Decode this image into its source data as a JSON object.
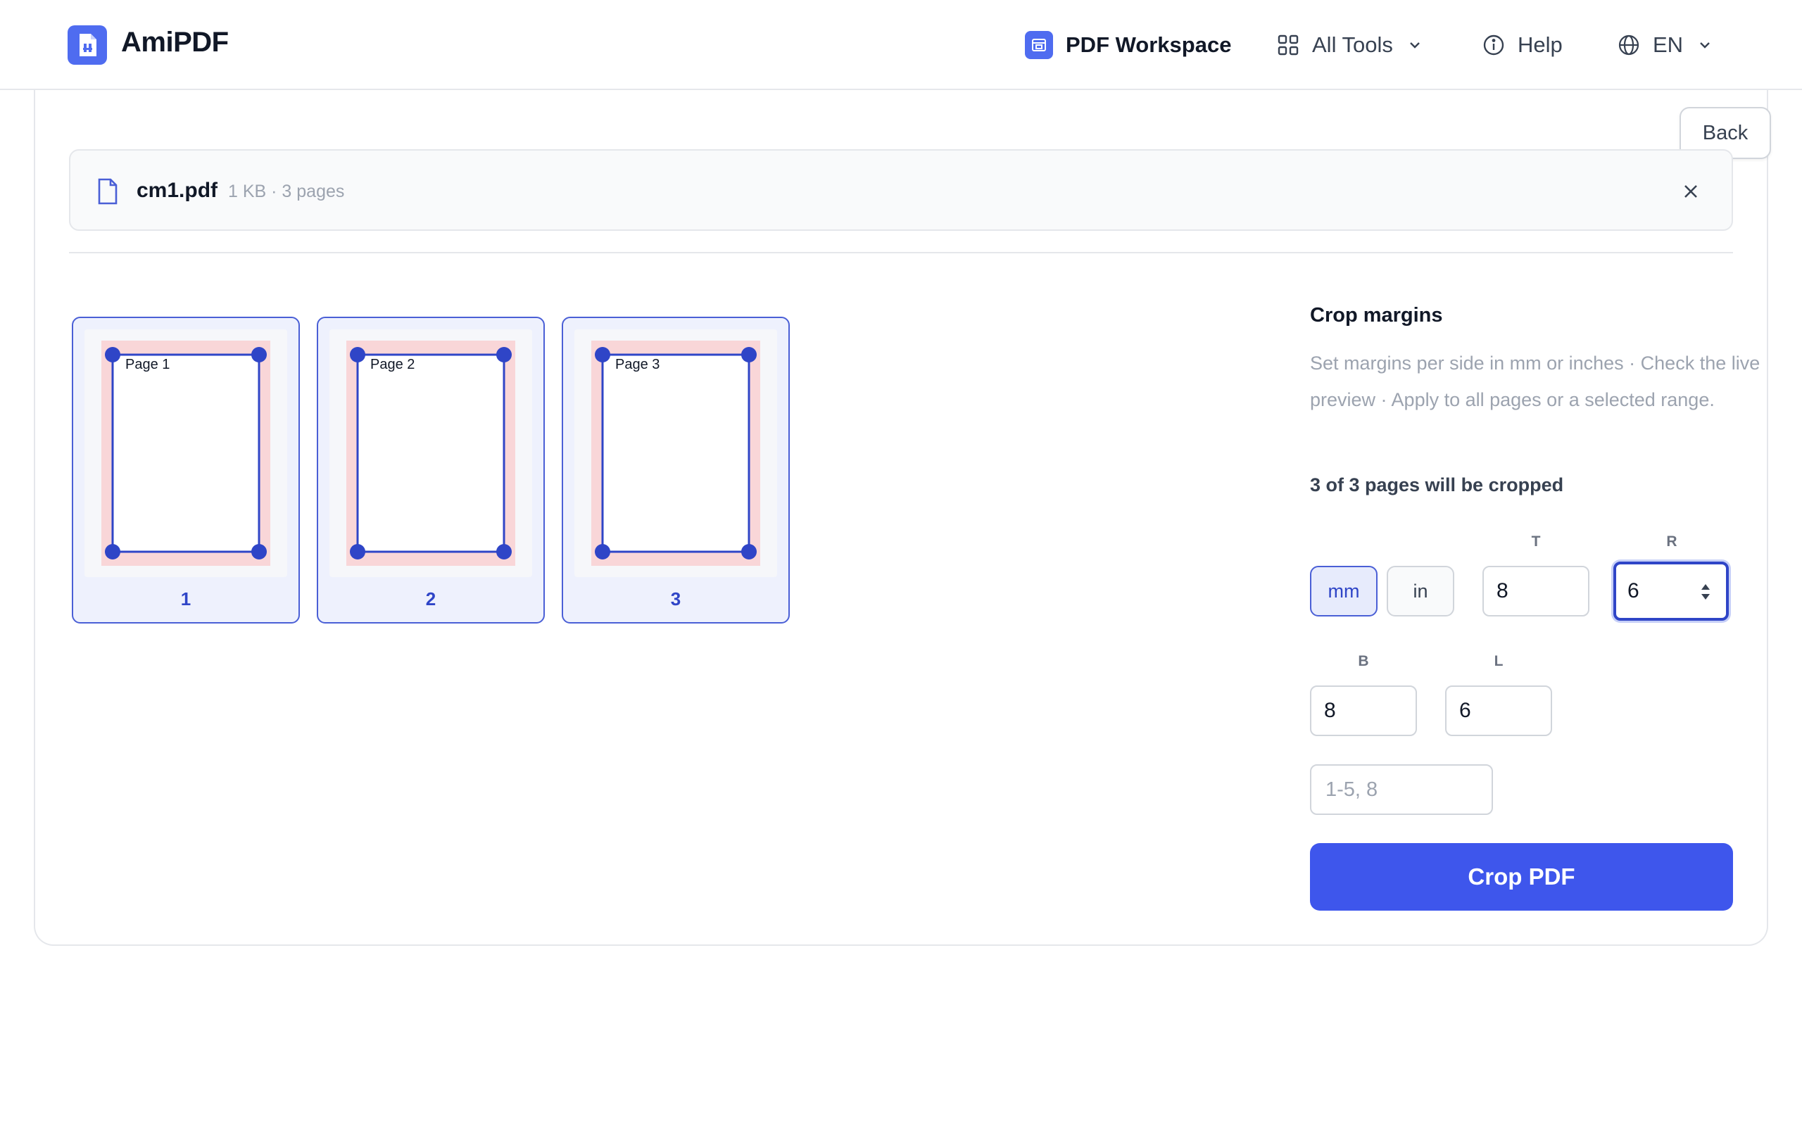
{
  "header": {
    "brand": "AmiPDF",
    "nav": {
      "workspace": "PDF Workspace",
      "all_tools": "All Tools",
      "help": "Help",
      "language": "EN"
    }
  },
  "back_label": "Back",
  "file": {
    "name": "cm1.pdf",
    "meta": "1 KB · 3 pages"
  },
  "thumbnails": [
    {
      "page_text": "Page 1",
      "number": "1"
    },
    {
      "page_text": "Page 2",
      "number": "2"
    },
    {
      "page_text": "Page 3",
      "number": "3"
    }
  ],
  "panel": {
    "title": "Crop margins",
    "description": "Set margins per side in mm or inches · Check the live preview · Apply to all pages or a selected range.",
    "count": "3 of 3 pages will be cropped",
    "units": {
      "mm": "mm",
      "in": "in",
      "selected": "mm"
    },
    "labels": {
      "top": "T",
      "right": "R",
      "bottom": "B",
      "left": "L"
    },
    "values": {
      "top": "8",
      "right": "6",
      "bottom": "8",
      "left": "6"
    },
    "range_placeholder": "1-5, 8",
    "crop_button": "Crop PDF"
  },
  "colors": {
    "accent": "#3e56ec",
    "crop_line": "#2f45c7",
    "margin_fill": "#f9d6d8"
  }
}
